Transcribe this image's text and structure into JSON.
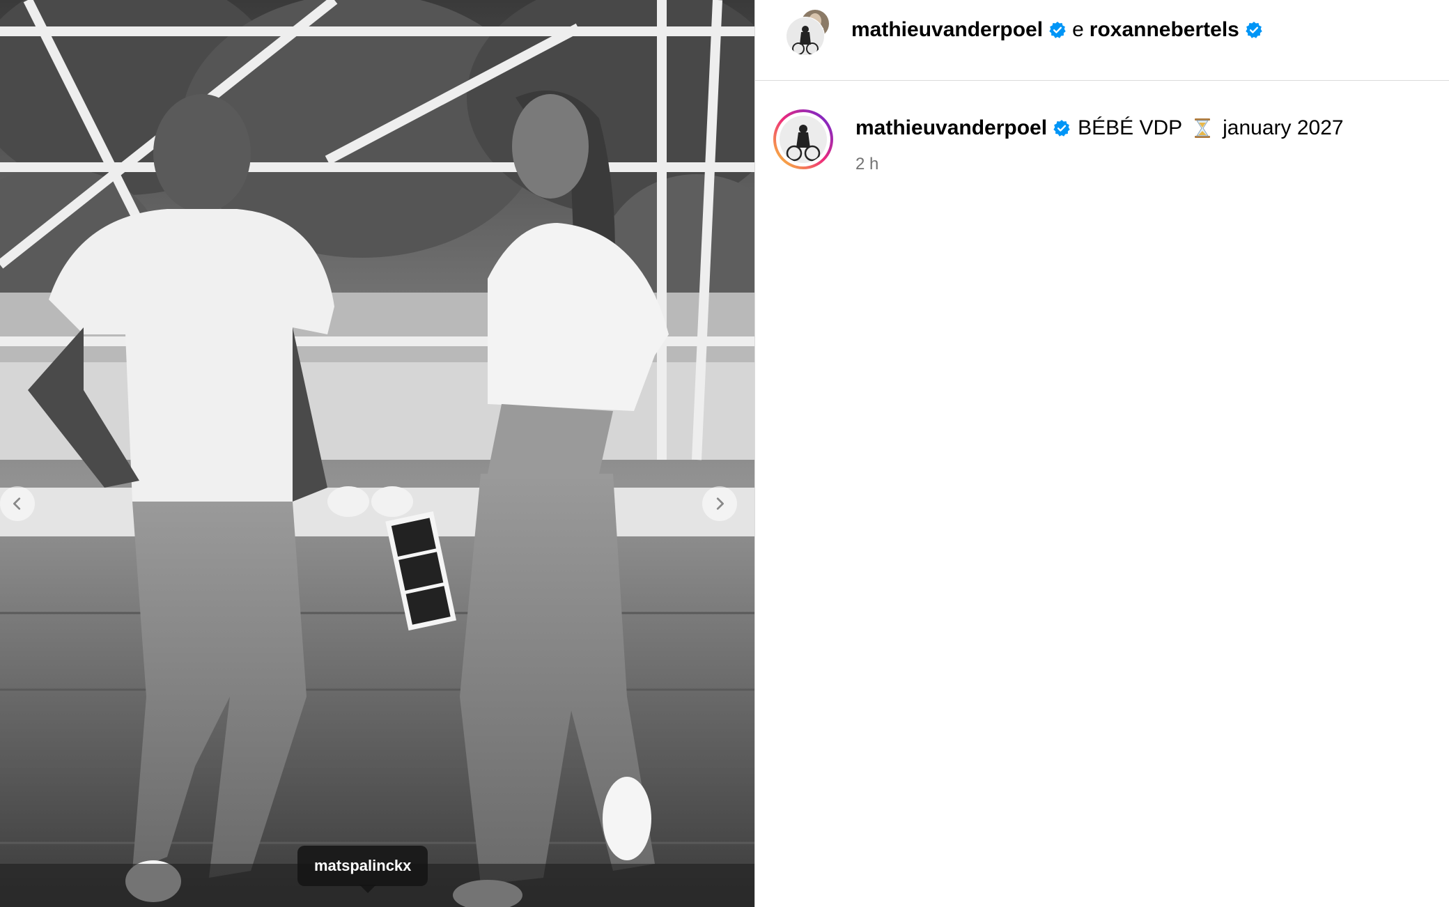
{
  "post": {
    "photo_tag": "matspalinckx"
  },
  "header": {
    "author": "mathieuvanderpoel",
    "conjunction": "e",
    "coauthor": "roxannebertels"
  },
  "caption": {
    "author": "mathieuvanderpoel",
    "text_before": "BÉBÉ VDP",
    "text_after": "january 2027",
    "time": "2 h"
  },
  "colors": {
    "verified": "#0095f6",
    "story_ring_start": "#f9ce34",
    "story_ring_mid": "#ee2a7b",
    "story_ring_end": "#6228d7",
    "secondary_text": "#737373"
  },
  "icons": {
    "verified": "verified-badge-icon",
    "hourglass": "hourglass-icon",
    "prev": "chevron-left-icon",
    "next": "chevron-right-icon"
  }
}
